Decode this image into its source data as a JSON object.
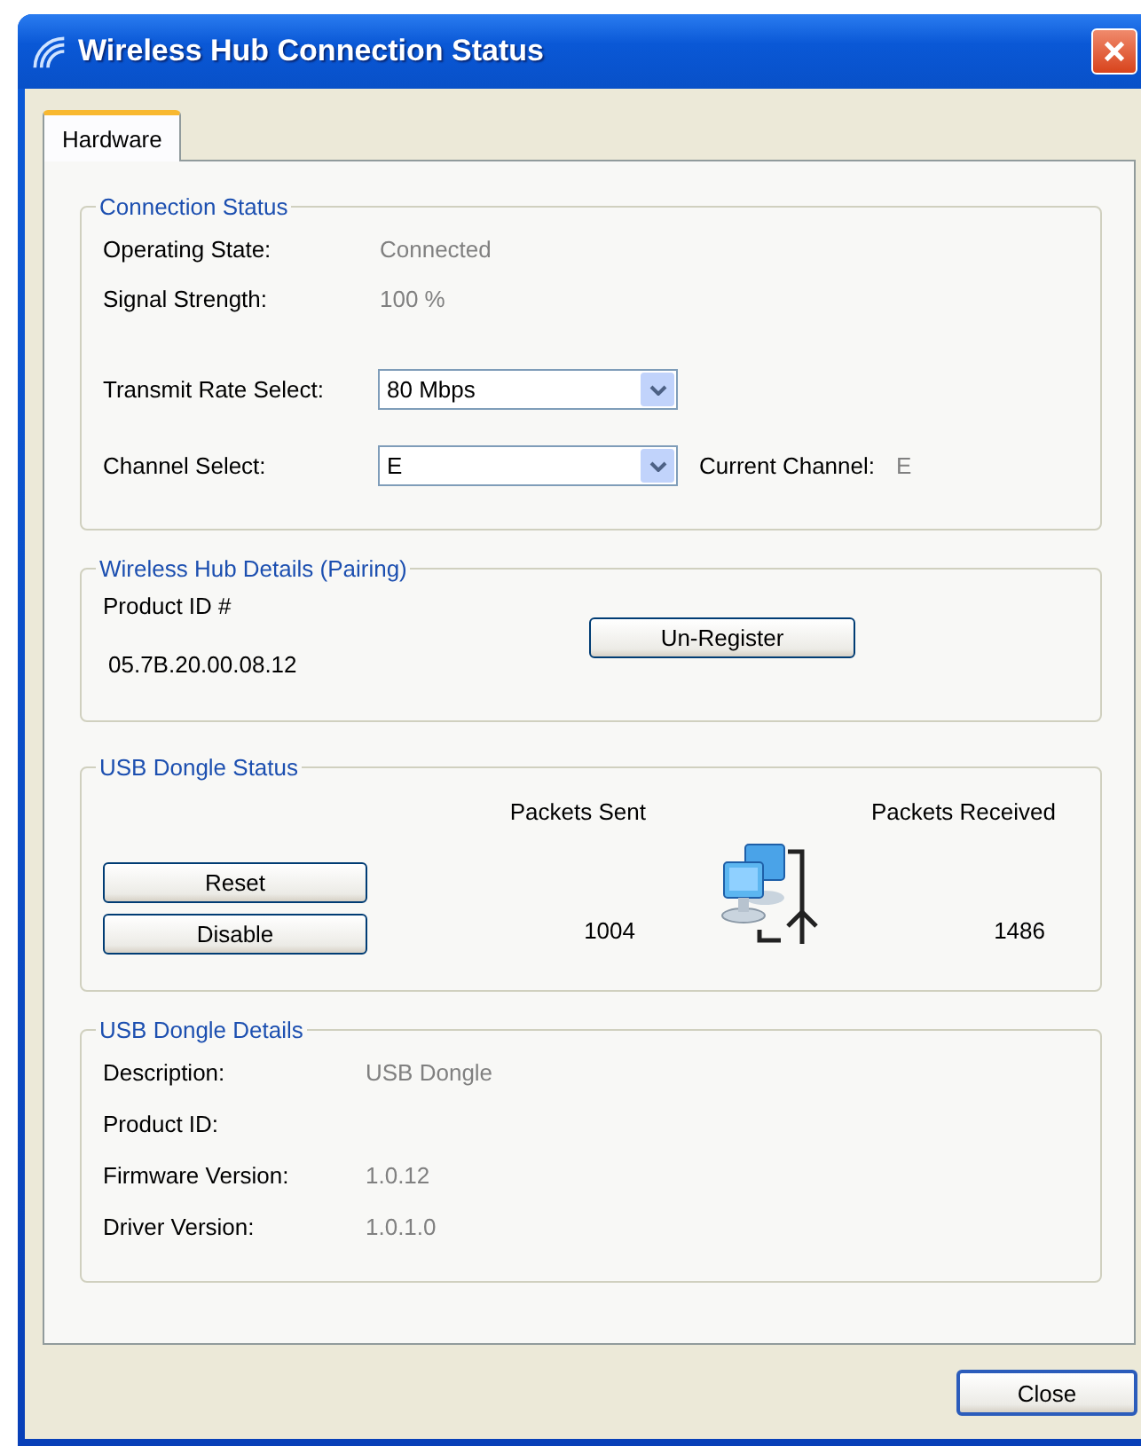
{
  "window": {
    "title": "Wireless Hub Connection Status"
  },
  "tabs": [
    {
      "label": "Hardware",
      "selected": true
    }
  ],
  "connection_status": {
    "title": "Connection Status",
    "fields": [
      {
        "label": "Operating State:",
        "value": "Connected"
      },
      {
        "label": "Signal Strength:",
        "value": "100 %"
      }
    ],
    "transmit_rate": {
      "label": "Transmit Rate Select:",
      "value": "80 Mbps"
    },
    "channel": {
      "label": "Channel Select:",
      "value": "E"
    },
    "current_channel": {
      "label": "Current Channel:",
      "value": "E"
    }
  },
  "hub_details": {
    "title": "Wireless Hub Details (Pairing)",
    "product_id_label": "Product ID #",
    "product_id": "05.7B.20.00.08.12",
    "button": "Un-Register"
  },
  "dongle_status": {
    "title": "USB Dongle Status",
    "buttons": [
      "Reset",
      "Disable"
    ],
    "packets_sent": {
      "label": "Packets Sent",
      "value": "1004"
    },
    "packets_received": {
      "label": "Packets Received",
      "value": "1486"
    }
  },
  "dongle_details": {
    "title": "USB Dongle Details",
    "fields": [
      {
        "label": "Description:",
        "value": "USB Dongle"
      },
      {
        "label": "Product ID:"
      },
      {
        "label": "Firmware Version:",
        "value": "1.0.12"
      },
      {
        "label": "Driver Version:",
        "value": "1.0.1.0"
      }
    ]
  },
  "buttons": [
    "Close"
  ]
}
